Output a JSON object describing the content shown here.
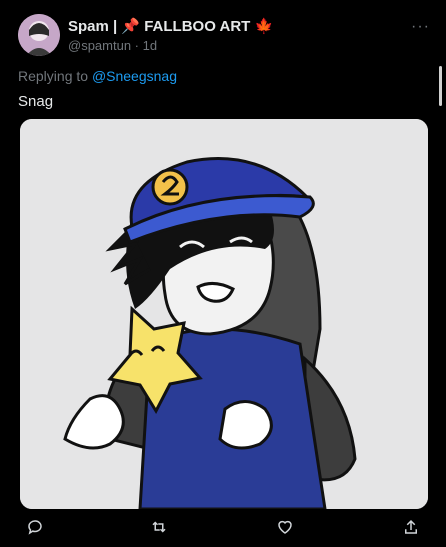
{
  "tweet": {
    "display_name": "Spam | 📌 FALLBOO ART 🍁",
    "handle_and_time": "@spamtun · 1d",
    "reply_prefix": "Replying to ",
    "reply_mention": "@Sneegsnag",
    "text": "Snag",
    "more_glyph": "···"
  },
  "actions": {
    "icons": [
      "reply-icon",
      "retweet-icon",
      "like-icon",
      "share-icon"
    ]
  },
  "colors": {
    "background": "#000000",
    "text": "#e7e9ea",
    "muted": "#71767b",
    "link": "#1d9bf0",
    "media_bg": "#e5e5e6",
    "cap_blue": "#2b3aa8",
    "sweater_blue": "#2a3c96",
    "star_yellow": "#f7e26a"
  }
}
